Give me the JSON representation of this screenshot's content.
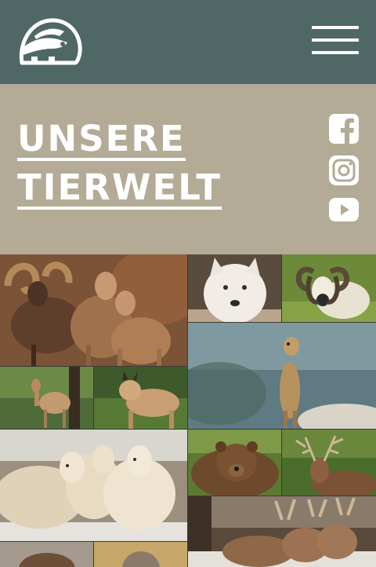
{
  "header": {
    "logo_icon": "badger-logo-icon",
    "menu_icon": "hamburger-menu-icon",
    "background": "#4f6866"
  },
  "hero": {
    "title_line1": "UNSERE",
    "title_line2": "TIERWELT",
    "background": "#b3ab95"
  },
  "social": [
    {
      "name": "facebook",
      "icon": "facebook-icon"
    },
    {
      "name": "instagram",
      "icon": "instagram-icon"
    },
    {
      "name": "youtube",
      "icon": "youtube-icon"
    }
  ],
  "gallery": {
    "tiles": [
      {
        "animal": "mouflon"
      },
      {
        "animal": "white-wolf"
      },
      {
        "animal": "ram"
      },
      {
        "animal": "meerkat"
      },
      {
        "animal": "deer"
      },
      {
        "animal": "lynx"
      },
      {
        "animal": "sheep"
      },
      {
        "animal": "brown-bear"
      },
      {
        "animal": "red-deer"
      },
      {
        "animal": "fallow-deer"
      }
    ]
  }
}
